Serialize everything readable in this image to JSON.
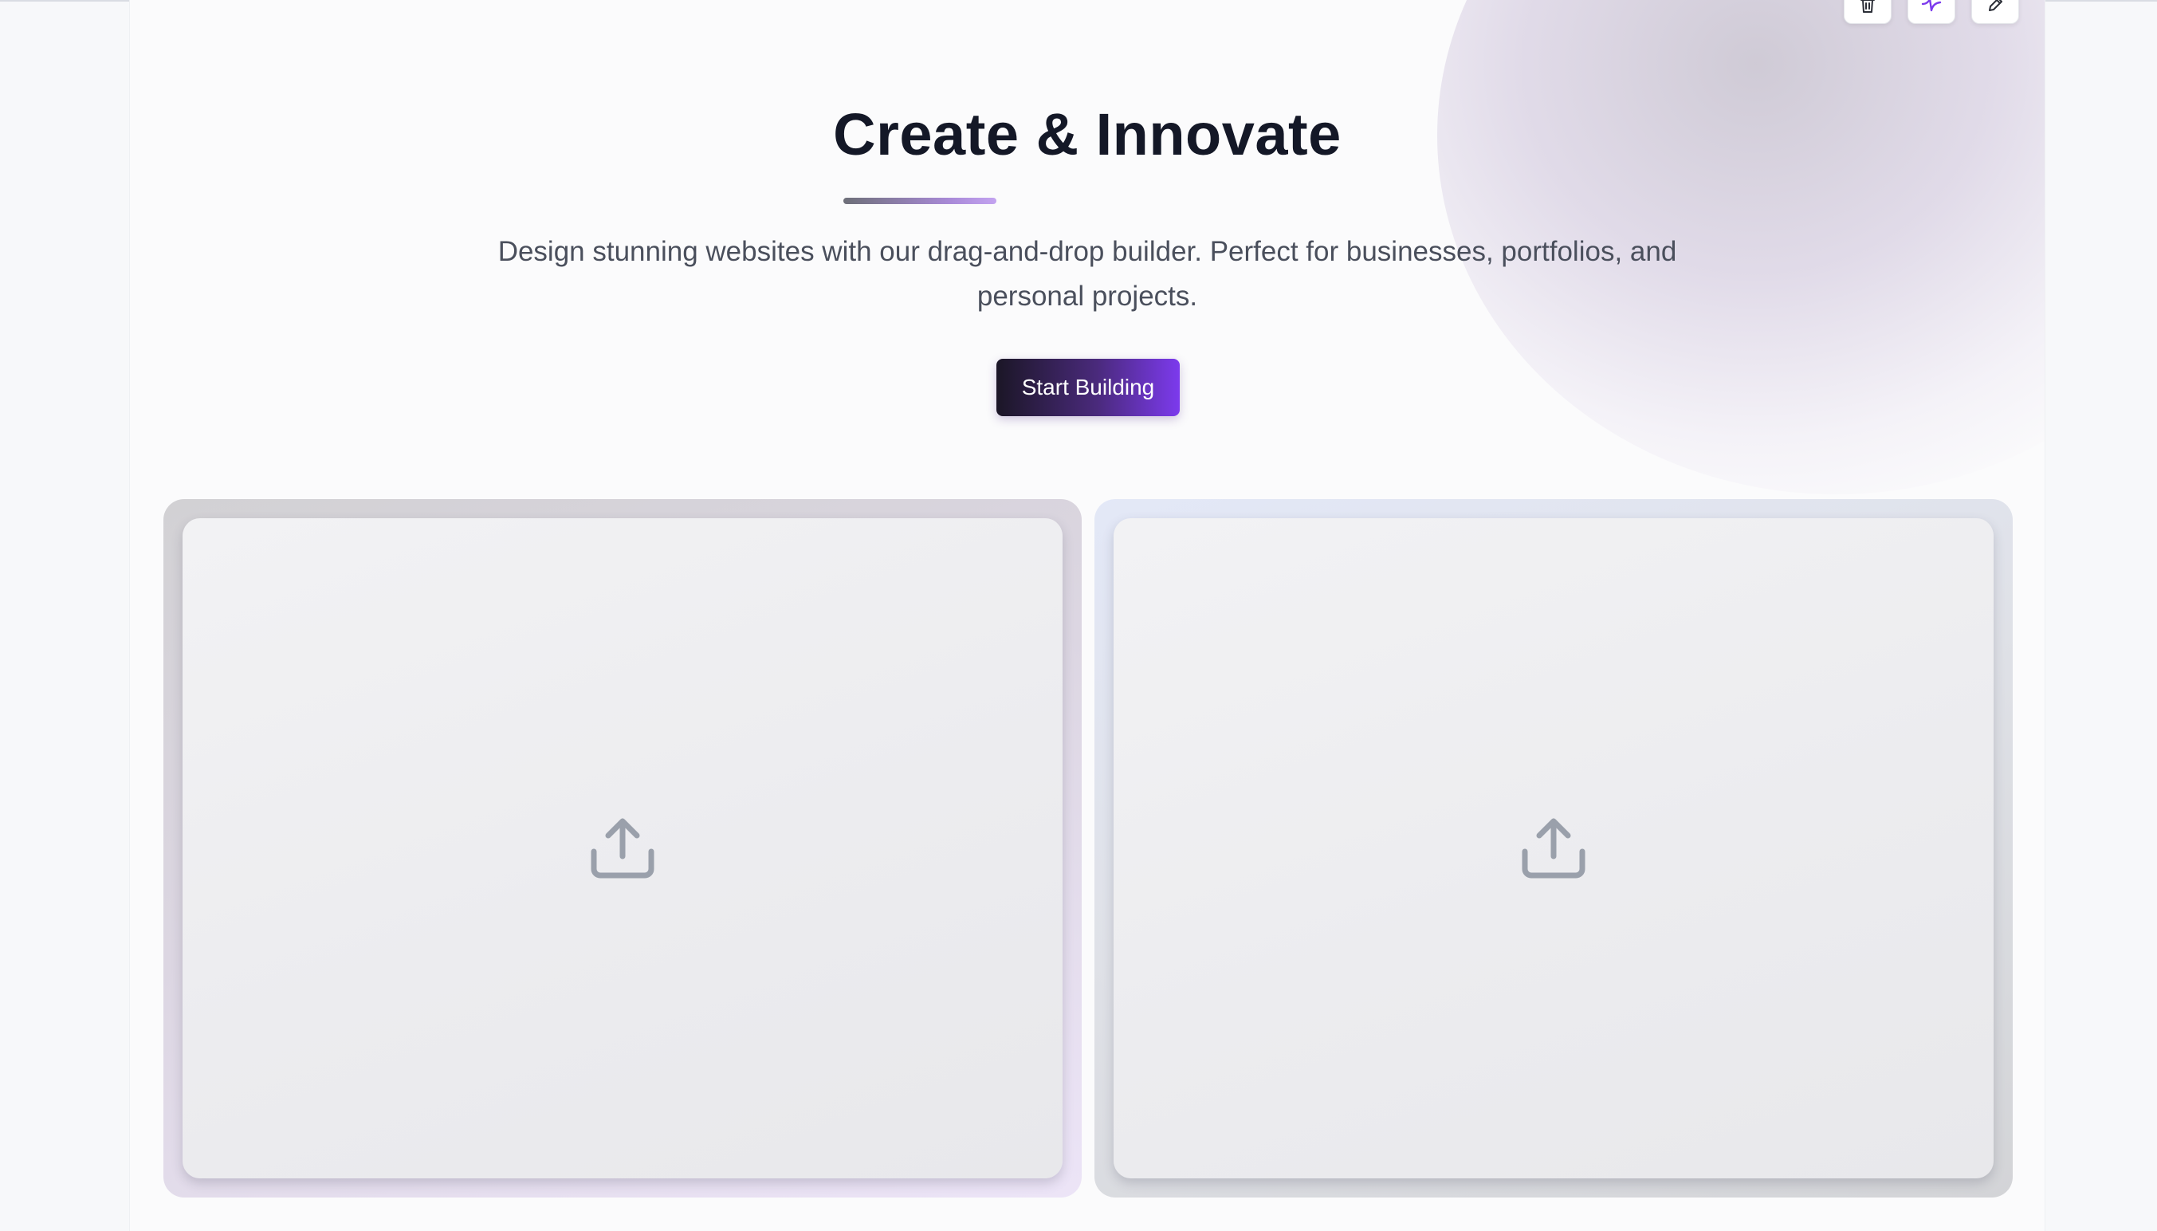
{
  "toolbar": {
    "icons": [
      "trash-icon",
      "sparkle-icon",
      "pencil-icon"
    ],
    "accent": "#7c3aed"
  },
  "hero": {
    "title": "Create & Innovate",
    "subtitle_line1": "Design stunning websites with our drag-and-drop builder. Perfect for businesses, portfolios, and",
    "subtitle_line2": "personal projects.",
    "cta_label": "Start Building"
  },
  "cards": [
    {
      "icon": "upload-icon"
    },
    {
      "icon": "upload-icon"
    }
  ],
  "colors": {
    "title": "#141827",
    "body_text": "#4a4f5c",
    "cta_start": "#1b1626",
    "cta_end": "#7c3aed",
    "icon_gray": "#9aa0ab"
  }
}
